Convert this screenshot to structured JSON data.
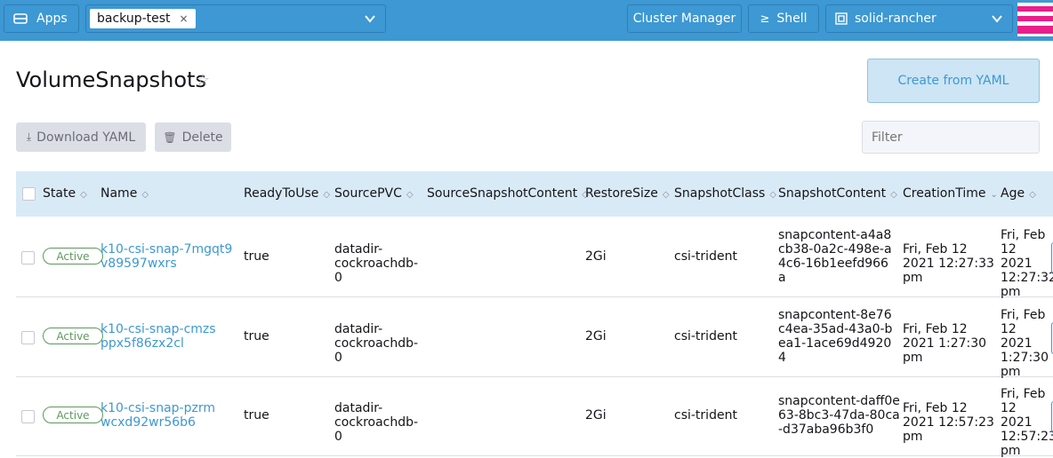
{
  "header": {
    "apps_label": "Apps",
    "namespace_chip": "backup-test",
    "chip_remove": "×",
    "cluster_manager_label": "Cluster Manager",
    "shell_label": "Shell",
    "shell_icon_glyph": "≥",
    "cluster_name": "solid-rancher"
  },
  "page": {
    "title": "VolumeSnapshots",
    "star": "☆",
    "create_label": "Create from YAML",
    "download_label": "Download YAML",
    "delete_label": "Delete",
    "filter_placeholder": "Filter"
  },
  "table": {
    "columns": [
      "State",
      "Name",
      "ReadyToUse",
      "SourcePVC",
      "SourceSnapshotContent",
      "RestoreSize",
      "SnapshotClass",
      "SnapshotContent",
      "CreationTime",
      "Age"
    ],
    "rows": [
      {
        "state": "Active",
        "name": "k10-csi-snap-7mgqt9v89597wxrs",
        "ready": "true",
        "pvc": "datadir-cockroachdb-0",
        "source_content": "",
        "size": "2Gi",
        "class": "csi-trident",
        "content": "snapcontent-a4a8cb38-0a2c-498e-a4c6-16b1eefd966a",
        "created": "Fri, Feb 12 2021 12:27:33 pm",
        "age": "Fri, Feb 12 2021 12:27:32 pm"
      },
      {
        "state": "Active",
        "name": "k10-csi-snap-cmzsppx5f86zx2cl",
        "ready": "true",
        "pvc": "datadir-cockroachdb-0",
        "source_content": "",
        "size": "2Gi",
        "class": "csi-trident",
        "content": "snapcontent-8e76c4ea-35ad-43a0-bea1-1ace69d49204",
        "created": "Fri, Feb 12 2021 1:27:30 pm",
        "age": "Fri, Feb 12 2021 1:27:30 pm"
      },
      {
        "state": "Active",
        "name": "k10-csi-snap-pzrmwcxd92wr56b6",
        "ready": "true",
        "pvc": "datadir-cockroachdb-0",
        "source_content": "",
        "size": "2Gi",
        "class": "csi-trident",
        "content": "snapcontent-daff0e63-8bc3-47da-80ca-d37aba96b3f0",
        "created": "Fri, Feb 12 2021 12:57:23 pm",
        "age": "Fri, Feb 12 2021 12:57:23 pm"
      }
    ]
  },
  "colors": {
    "header_bg": "#3d98d3",
    "table_header_bg": "#d9eaf7",
    "link": "#3d98d3",
    "active_badge": "#5d995d",
    "avatar_accent": "#e91e8c"
  }
}
